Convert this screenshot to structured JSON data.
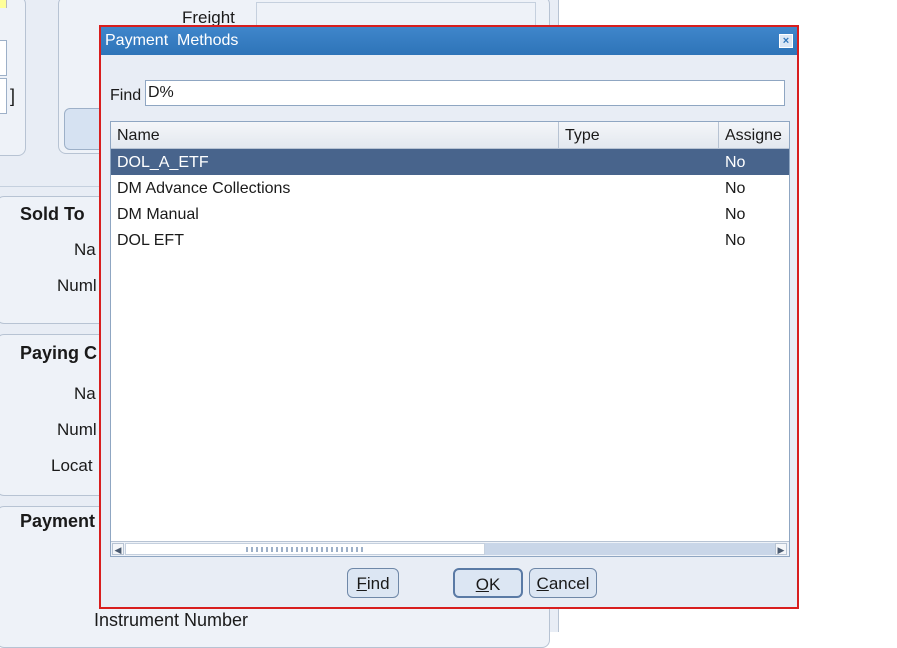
{
  "background": {
    "bracket": "]",
    "freight_label": "Freight",
    "sold_to": {
      "title": "Sold To",
      "name_label": "Na",
      "number_label": "Numl"
    },
    "paying": {
      "title": "Paying C",
      "name_label": "Na",
      "number_label": "Numl",
      "location_label": "Locat"
    },
    "payment": {
      "title": "Payment",
      "instrument_label": "Instrument Number"
    }
  },
  "dialog": {
    "title": "Payment  Methods",
    "close_icon": "close-icon",
    "find_label": "Find",
    "find_value": "D%",
    "columns": [
      "Name",
      "Type",
      "Assigne"
    ],
    "rows": [
      {
        "name": "DOL_A_ETF",
        "type": "",
        "assigned": "No",
        "selected": true
      },
      {
        "name": "DM Advance Collections",
        "type": "",
        "assigned": "No",
        "selected": false
      },
      {
        "name": "DM Manual",
        "type": "",
        "assigned": "No",
        "selected": false
      },
      {
        "name": "DOL EFT",
        "type": "",
        "assigned": "No",
        "selected": false
      }
    ],
    "buttons": {
      "find": {
        "mnemonic": "F",
        "rest": "ind"
      },
      "ok": {
        "mnemonic": "O",
        "rest": "K"
      },
      "cancel": {
        "mnemonic": "C",
        "rest": "ancel"
      }
    },
    "colors": {
      "titlebar": "#2e74b8",
      "selection": "#48648c",
      "dialog_border": "#d81e1e"
    }
  }
}
